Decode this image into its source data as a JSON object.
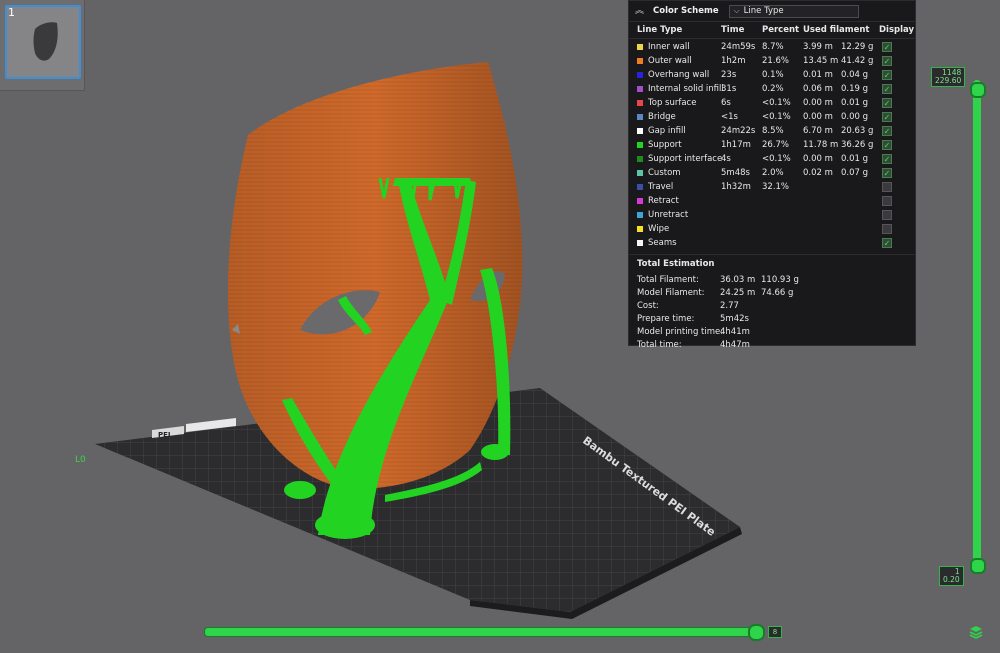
{
  "plate_thumbnail": {
    "number": "1"
  },
  "legend": {
    "title": "Color Scheme",
    "view_select": "Line Type",
    "columns": {
      "line_type": "Line Type",
      "time": "Time",
      "percent": "Percent",
      "used_filament": "Used filament",
      "display": "Display"
    },
    "rows": [
      {
        "name": "Inner wall",
        "color": "#f2d44a",
        "time": "24m59s",
        "percent": "8.7%",
        "length": "3.99 m",
        "weight": "12.29 g",
        "display": true
      },
      {
        "name": "Outer wall",
        "color": "#f07d24",
        "time": "1h2m",
        "percent": "21.6%",
        "length": "13.45 m",
        "weight": "41.42 g",
        "display": true
      },
      {
        "name": "Overhang wall",
        "color": "#2424e0",
        "time": "23s",
        "percent": "0.1%",
        "length": "0.01 m",
        "weight": "0.04 g",
        "display": true
      },
      {
        "name": "Internal solid infill",
        "color": "#a14ec7",
        "time": "31s",
        "percent": "0.2%",
        "length": "0.06 m",
        "weight": "0.19 g",
        "display": true
      },
      {
        "name": "Top surface",
        "color": "#e8464a",
        "time": "6s",
        "percent": "<0.1%",
        "length": "0.00 m",
        "weight": "0.01 g",
        "display": true
      },
      {
        "name": "Bridge",
        "color": "#5a86c2",
        "time": "<1s",
        "percent": "<0.1%",
        "length": "0.00 m",
        "weight": "0.00 g",
        "display": true
      },
      {
        "name": "Gap infill",
        "color": "#ffffff",
        "time": "24m22s",
        "percent": "8.5%",
        "length": "6.70 m",
        "weight": "20.63 g",
        "display": true
      },
      {
        "name": "Support",
        "color": "#22d421",
        "time": "1h17m",
        "percent": "26.7%",
        "length": "11.78 m",
        "weight": "36.26 g",
        "display": true
      },
      {
        "name": "Support interface",
        "color": "#1f8a1f",
        "time": "4s",
        "percent": "<0.1%",
        "length": "0.00 m",
        "weight": "0.01 g",
        "display": true
      },
      {
        "name": "Custom",
        "color": "#5ec5a4",
        "time": "5m48s",
        "percent": "2.0%",
        "length": "0.02 m",
        "weight": "0.07 g",
        "display": true
      },
      {
        "name": "Travel",
        "color": "#3a4fa8",
        "time": "1h32m",
        "percent": "32.1%",
        "length": "",
        "weight": "",
        "display": false
      },
      {
        "name": "Retract",
        "color": "#d23cd2",
        "time": "",
        "percent": "",
        "length": "",
        "weight": "",
        "display": false
      },
      {
        "name": "Unretract",
        "color": "#3ca5d8",
        "time": "",
        "percent": "",
        "length": "",
        "weight": "",
        "display": false
      },
      {
        "name": "Wipe",
        "color": "#f2e22a",
        "time": "",
        "percent": "",
        "length": "",
        "weight": "",
        "display": false
      },
      {
        "name": "Seams",
        "color": "#f4f4f4",
        "time": "",
        "percent": "",
        "length": "",
        "weight": "",
        "display": true
      }
    ],
    "total_title": "Total Estimation",
    "totals": [
      {
        "label": "Total Filament:",
        "v1": "36.03 m",
        "v2": "110.93 g"
      },
      {
        "label": "Model Filament:",
        "v1": "24.25 m",
        "v2": "74.66 g"
      },
      {
        "label": "Cost:",
        "v1": "2.77",
        "v2": ""
      },
      {
        "label": "Prepare time:",
        "v1": "5m42s",
        "v2": ""
      },
      {
        "label": "Model printing time:",
        "v1": "4h41m",
        "v2": ""
      },
      {
        "label": "Total time:",
        "v1": "4h47m",
        "v2": ""
      }
    ]
  },
  "layer_slider": {
    "top_layer": "1148",
    "top_height": "229.60",
    "bottom_layer": "1",
    "bottom_height": "0.20"
  },
  "move_slider": {
    "value": "8"
  },
  "plate": {
    "label": "Bambu Textured PEI Plate",
    "axis_label": "L0",
    "corner_tag": "PEI"
  },
  "colors": {
    "accent": "#2fd44a",
    "model": "#d26a2c",
    "support": "#22d421"
  }
}
